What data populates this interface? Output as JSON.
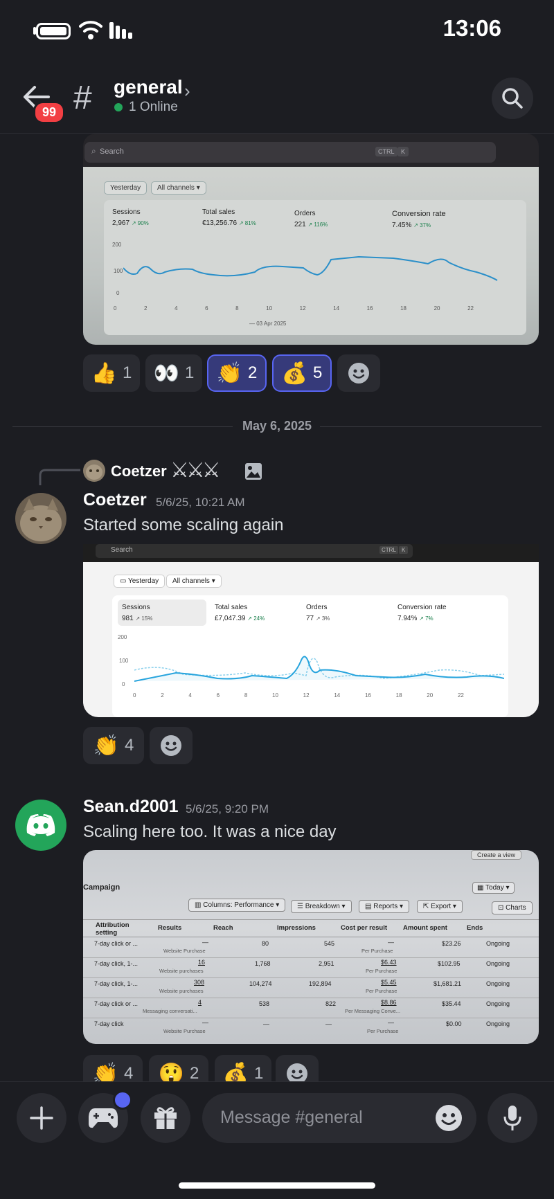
{
  "status_bar": {
    "time": "13:06"
  },
  "header": {
    "unread_badge": "99",
    "channel_name": "general",
    "online_status": "1 Online"
  },
  "screenshot1": {
    "search_placeholder": "Search",
    "shortcut_ctrl": "CTRL",
    "shortcut_k": "K",
    "filter_date": "Yesterday",
    "filter_channels": "All channels",
    "metrics": [
      {
        "label": "Sessions",
        "value": "2,967",
        "change": "↗ 90%"
      },
      {
        "label": "Total sales",
        "value": "€13,256.76",
        "change": "↗ 81%"
      },
      {
        "label": "Orders",
        "value": "221",
        "change": "↗ 116%"
      },
      {
        "label": "Conversion rate",
        "value": "7.45%",
        "change": "↗ 37%"
      }
    ],
    "y_ticks": [
      "200",
      "100",
      "0"
    ],
    "x_ticks": [
      "0",
      "2",
      "4",
      "6",
      "8",
      "10",
      "12",
      "14",
      "16",
      "18",
      "20",
      "22"
    ],
    "legend": "03 Apr 2025"
  },
  "reactions1": [
    {
      "emoji": "👍",
      "count": "1",
      "active": false
    },
    {
      "emoji": "👀",
      "count": "1",
      "active": false
    },
    {
      "emoji": "👏",
      "count": "2",
      "active": true
    },
    {
      "emoji": "💰",
      "count": "5",
      "active": true
    }
  ],
  "date_divider": "May 6, 2025",
  "reply": {
    "author": "Coetzer",
    "decoration": "⚔⚔⚔"
  },
  "message1": {
    "author": "Coetzer",
    "timestamp": "5/6/25, 10:21 AM",
    "text": "Started some scaling again"
  },
  "screenshot2": {
    "search_placeholder": "Search",
    "shortcut_ctrl": "CTRL",
    "shortcut_k": "K",
    "filter_date": "Yesterday",
    "filter_channels": "All channels",
    "metrics": [
      {
        "label": "Sessions",
        "value": "981",
        "change": "↗ 15%"
      },
      {
        "label": "Total sales",
        "value": "£7,047.39",
        "change": "↗ 24%"
      },
      {
        "label": "Orders",
        "value": "77",
        "change": "↗ 3%"
      },
      {
        "label": "Conversion rate",
        "value": "7.94%",
        "change": "↗ 7%"
      }
    ],
    "y_ticks": [
      "200",
      "100",
      "0"
    ],
    "x_ticks": [
      "0",
      "2",
      "4",
      "6",
      "8",
      "10",
      "12",
      "14",
      "16",
      "18",
      "20",
      "22"
    ]
  },
  "reactions2": [
    {
      "emoji": "👏",
      "count": "4",
      "active": false
    }
  ],
  "message2": {
    "author": "Sean.d2001",
    "timestamp": "5/6/25, 9:20 PM",
    "text": "Scaling here too. It was a nice day"
  },
  "screenshot3": {
    "top_button": "Create a view",
    "title": "Campaign",
    "today": "Today",
    "toolbar": [
      "Columns: Performance",
      "Breakdown",
      "Reports",
      "Export",
      "Charts"
    ],
    "columns": [
      "Attribution setting",
      "Results",
      "Reach",
      "Impressions",
      "Cost per result",
      "Amount spent",
      "Ends"
    ],
    "rows": [
      {
        "attr": "7-day click or ...",
        "result": "—",
        "result_sub": "Website Purchase",
        "reach": "80",
        "impr": "545",
        "cpr": "—",
        "cpr_sub": "Per Purchase",
        "spent": "$23.26",
        "ends": "Ongoing"
      },
      {
        "attr": "7-day click, 1-...",
        "result": "16",
        "result_sub": "Website purchases",
        "reach": "1,768",
        "impr": "2,951",
        "cpr": "$6.43",
        "cpr_sub": "Per Purchase",
        "spent": "$102.95",
        "ends": "Ongoing"
      },
      {
        "attr": "7-day click, 1-...",
        "result": "308",
        "result_sub": "Website purchases",
        "reach": "104,274",
        "impr": "192,894",
        "cpr": "$5.45",
        "cpr_sub": "Per Purchase",
        "spent": "$1,681.21",
        "ends": "Ongoing"
      },
      {
        "attr": "7-day click or ...",
        "result": "4",
        "result_sub": "Messaging conversati...",
        "reach": "538",
        "impr": "822",
        "cpr": "$8.86",
        "cpr_sub": "Per Messaging Conve...",
        "spent": "$35.44",
        "ends": "Ongoing"
      },
      {
        "attr": "7-day click",
        "result": "—",
        "result_sub": "Website Purchase",
        "reach": "—",
        "impr": "—",
        "cpr": "—",
        "cpr_sub": "Per Purchase",
        "spent": "$0.00",
        "ends": "Ongoing"
      }
    ]
  },
  "reactions3": [
    {
      "emoji": "👏",
      "count": "4"
    },
    {
      "emoji": "😲",
      "count": "2"
    },
    {
      "emoji": "💰",
      "count": "1"
    }
  ],
  "composer": {
    "placeholder": "Message #general"
  },
  "colors": {
    "background": "#1c1d22",
    "accent": "#5865f2",
    "online": "#23a55a",
    "badge": "#f23f43",
    "discord_avatar": "#23a55a"
  }
}
